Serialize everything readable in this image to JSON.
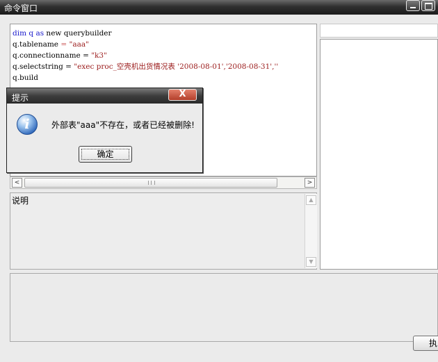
{
  "window": {
    "title": "命令窗口"
  },
  "editor": {
    "lines": [
      [
        {
          "t": "dim q ",
          "c": "kw"
        },
        {
          "t": "as",
          "c": "kw"
        },
        {
          "t": " new querybuilder",
          "c": ""
        }
      ],
      [
        {
          "t": "q.tablename ",
          "c": ""
        },
        {
          "t": "= ",
          "c": "op"
        },
        {
          "t": "\"aaa\"",
          "c": "str"
        }
      ],
      [
        {
          "t": "q.connectionname = ",
          "c": ""
        },
        {
          "t": "\"k3\"",
          "c": "str"
        }
      ],
      [
        {
          "t": "q.selectstring = ",
          "c": ""
        },
        {
          "t": "\"exec proc_空壳机出货情况表 '2008-08-01','2008-08-31',''",
          "c": "str"
        }
      ],
      [
        {
          "t": "q.build",
          "c": ""
        }
      ]
    ]
  },
  "scrollbar": {
    "left_arrow": "<",
    "right_arrow": ">"
  },
  "description": {
    "label": "说明"
  },
  "dialog": {
    "title": "提示",
    "close": "X",
    "icon": "info-icon",
    "icon_glyph": "i",
    "message": "外部表\"aaa\"不存在，或者已经被删除!",
    "ok_label": "确定"
  },
  "bottom": {
    "exec_label": "执"
  },
  "colors": {
    "keyword": "#1a1acb",
    "string": "#9b1b1b"
  }
}
